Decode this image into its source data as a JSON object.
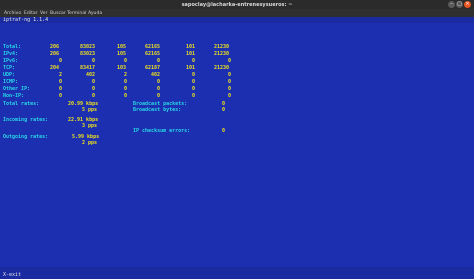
{
  "window": {
    "title": "sapoclay@lacharka-entrenesysueros: ~",
    "menu": [
      "Archivo",
      "Editar",
      "Ver",
      "Buscar",
      "Terminal",
      "Ayuda"
    ]
  },
  "iptraf": {
    "header": "iptraf-ng 1.1.4",
    "rows": [
      {
        "label": "Total:",
        "vals": [
          "206",
          "83023",
          "105",
          "62165",
          "101",
          "21230"
        ]
      },
      {
        "label": "IPv4:",
        "vals": [
          "206",
          "83023",
          "105",
          "62165",
          "101",
          "21230"
        ]
      },
      {
        "label": "IPv6:",
        "vals": [
          "0",
          "0",
          "0",
          "0",
          "0",
          "0"
        ]
      },
      {
        "label": "TCP:",
        "vals": [
          "204",
          "83417",
          "103",
          "62187",
          "101",
          "21230"
        ]
      },
      {
        "label": "UDP:",
        "vals": [
          "2",
          "402",
          "2",
          "402",
          "0",
          "0"
        ]
      },
      {
        "label": "ICMP:",
        "vals": [
          "0",
          "0",
          "0",
          "0",
          "0",
          "0"
        ]
      },
      {
        "label": "Other IP:",
        "vals": [
          "0",
          "0",
          "0",
          "0",
          "0",
          "0"
        ]
      },
      {
        "label": "Non-IP:",
        "vals": [
          "0",
          "0",
          "0",
          "0",
          "0",
          "0"
        ]
      }
    ],
    "rates": {
      "total_label": "Total rates:",
      "total_kbps": "20.99 kbps",
      "total_pps": "5 pps",
      "incoming_label": "Incoming rates:",
      "incoming_kbps": "22.91 kbps",
      "incoming_pps": "3 pps",
      "outgoing_label": "Outgoing rates:",
      "outgoing_kbps": "5.99 kbps",
      "outgoing_pps": "2 pps"
    },
    "broadcast": {
      "packets_label": "Broadcast packets:",
      "packets_value": "0",
      "bytes_label": "Broadcast bytes:",
      "bytes_value": "0",
      "checksum_label": "IP checksum errors:",
      "checksum_value": "0"
    },
    "footer": "X-exit"
  },
  "colors": {
    "terminal_bg": "#1b2fb0",
    "label": "#29d7e6",
    "value": "#f0e21c",
    "text": "#e8e8e8"
  }
}
